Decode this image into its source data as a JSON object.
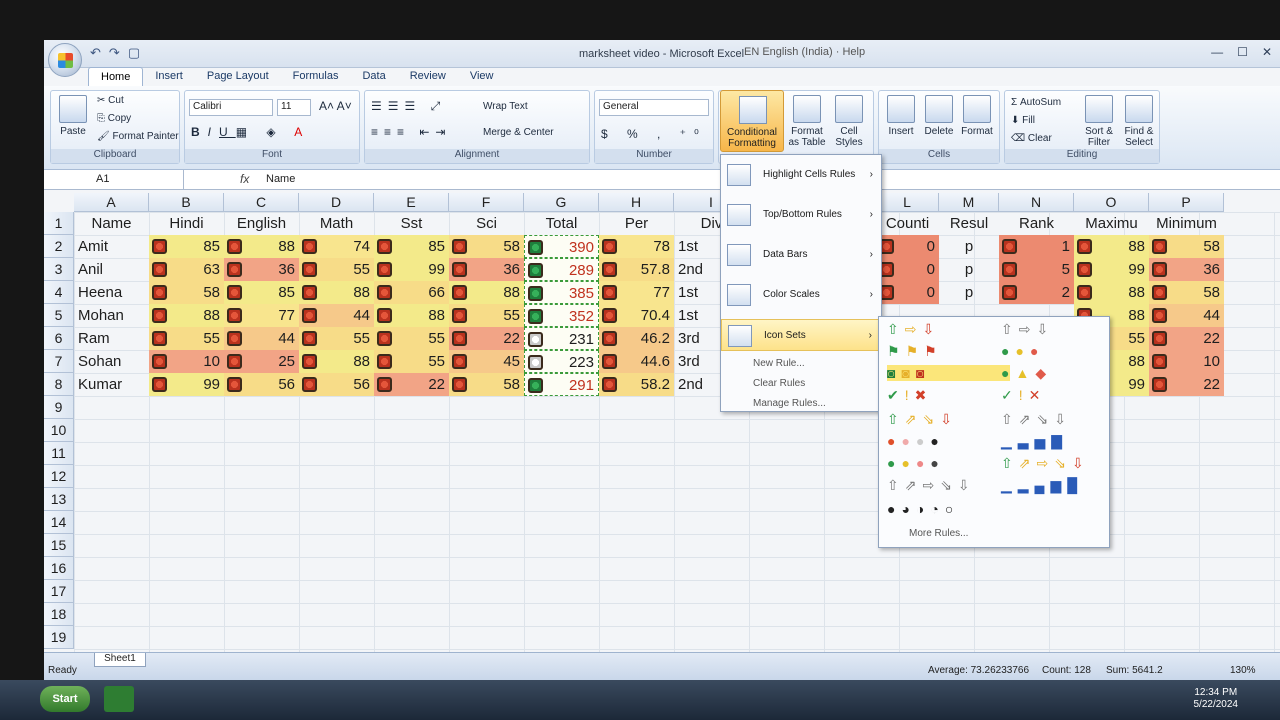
{
  "window": {
    "title": "marksheet video - Microsoft Excel",
    "help": "Help",
    "float_text": "EN English (India)"
  },
  "tabs": [
    "Home",
    "Insert",
    "Page Layout",
    "Formulas",
    "Data",
    "Review",
    "View"
  ],
  "ribbon": {
    "clipboard": {
      "paste": "Paste",
      "cut": "Cut",
      "copy": "Copy",
      "painter": "Format Painter",
      "label": "Clipboard"
    },
    "font": {
      "name": "Calibri",
      "size": "11",
      "label": "Font"
    },
    "alignment": {
      "wrap": "Wrap Text",
      "merge": "Merge & Center",
      "label": "Alignment"
    },
    "number": {
      "format": "General",
      "label": "Number"
    },
    "styles": {
      "cf": "Conditional Formatting",
      "fat": "Format as Table",
      "cs": "Cell Styles"
    },
    "cells": {
      "insert": "Insert",
      "delete": "Delete",
      "format": "Format",
      "label": "Cells"
    },
    "editing": {
      "autosum": "AutoSum",
      "fill": "Fill",
      "clear": "Clear",
      "sort": "Sort & Filter",
      "find": "Find & Select",
      "label": "Editing"
    }
  },
  "formula_bar": {
    "name_box": "A1",
    "fx": "fx",
    "value": "Name"
  },
  "columns": [
    "A",
    "B",
    "C",
    "D",
    "E",
    "F",
    "G",
    "H",
    "I",
    "L",
    "M",
    "N",
    "O",
    "P"
  ],
  "rows": [
    "1",
    "2",
    "3",
    "4",
    "5",
    "6",
    "7",
    "8",
    "9",
    "10",
    "11",
    "12",
    "13",
    "14",
    "15",
    "16",
    "17",
    "18",
    "19"
  ],
  "headers": {
    "A": "Name",
    "B": "Hindi",
    "C": "English",
    "D": "Math",
    "E": "Sst",
    "F": "Sci",
    "G": "Total",
    "H": "Per",
    "I": "Div",
    "L": "Counti",
    "M": "Resul",
    "N": "Rank",
    "O": "Maximu",
    "P": "Minimum"
  },
  "table": [
    {
      "name": "Amit",
      "b": "85",
      "c": "88",
      "d": "74",
      "e": "85",
      "f": "58",
      "g": "390",
      "h": "78",
      "i": "1st",
      "l": "0",
      "m": "p",
      "n": "1",
      "o": "88",
      "p": "58"
    },
    {
      "name": "Anil",
      "b": "63",
      "c": "36",
      "d": "55",
      "e": "99",
      "f": "36",
      "g": "289",
      "h": "57.8",
      "i": "2nd",
      "l": "0",
      "m": "p",
      "n": "5",
      "o": "99",
      "p": "36"
    },
    {
      "name": "Heena",
      "b": "58",
      "c": "85",
      "d": "88",
      "e": "66",
      "f": "88",
      "g": "385",
      "h": "77",
      "i": "1st",
      "l": "0",
      "m": "p",
      "n": "2",
      "o": "88",
      "p": "58"
    },
    {
      "name": "Mohan",
      "b": "88",
      "c": "77",
      "d": "44",
      "e": "88",
      "f": "55",
      "g": "352",
      "h": "70.4",
      "i": "1st",
      "o": "88",
      "p": "44"
    },
    {
      "name": "Ram",
      "b": "55",
      "c": "44",
      "d": "55",
      "e": "55",
      "f": "22",
      "g": "231",
      "h": "46.2",
      "i": "3rd",
      "o": "55",
      "p": "22"
    },
    {
      "name": "Sohan",
      "b": "10",
      "c": "25",
      "d": "88",
      "e": "55",
      "f": "45",
      "g": "223",
      "h": "44.6",
      "i": "3rd",
      "o": "88",
      "p": "10"
    },
    {
      "name": "Kumar",
      "b": "99",
      "c": "56",
      "d": "56",
      "e": "22",
      "f": "58",
      "g": "291",
      "h": "58.2",
      "i": "2nd",
      "o": "99",
      "p": "22"
    }
  ],
  "menu": {
    "items": [
      "Highlight Cells Rules",
      "Top/Bottom Rules",
      "Data Bars",
      "Color Scales",
      "Icon Sets"
    ],
    "sub": [
      "New Rule...",
      "Clear Rules",
      "Manage Rules..."
    ],
    "more": "More Rules..."
  },
  "status": {
    "ready": "Ready",
    "sheet": "Sheet1",
    "average": "Average: 73.26233766",
    "count": "Count: 128",
    "sum": "Sum: 5641.2",
    "zoom": "130%"
  },
  "taskbar": {
    "start": "Start",
    "time": "12:34 PM",
    "date": "5/22/2024"
  }
}
